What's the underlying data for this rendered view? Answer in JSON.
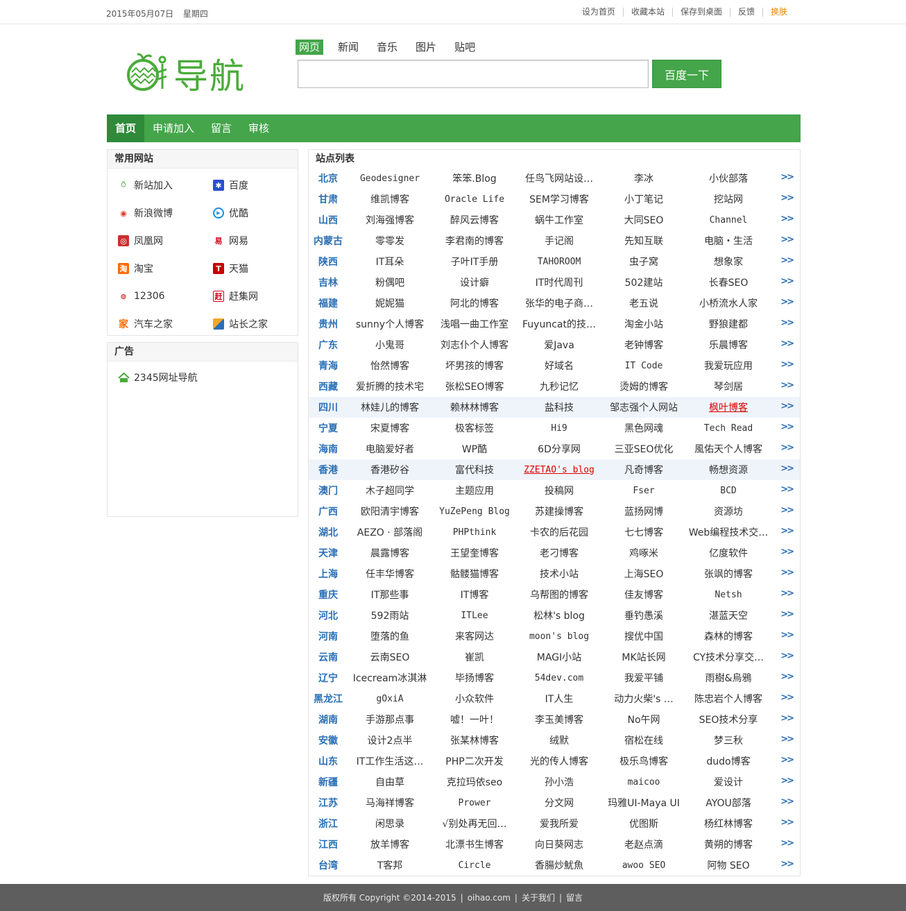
{
  "topbar": {
    "date": "2015年05月07日",
    "weekday": "星期四",
    "links": [
      "设为首页",
      "收藏本站",
      "保存到桌面",
      "反馈",
      "换肤"
    ]
  },
  "logo": {
    "text": "导航"
  },
  "search": {
    "tabs": [
      "网页",
      "新闻",
      "音乐",
      "图片",
      "贴吧"
    ],
    "active_tab": "网页",
    "button": "百度一下",
    "value": ""
  },
  "nav": {
    "items": [
      "首页",
      "申请加入",
      "留言",
      "审核"
    ]
  },
  "common_sites": {
    "title": "常用网站",
    "items": [
      {
        "label": "新站加入",
        "icon": "oihao-icon"
      },
      {
        "label": "百度",
        "icon": "baidu-paw-icon"
      },
      {
        "label": "新浪微博",
        "icon": "weibo-icon"
      },
      {
        "label": "优酷",
        "icon": "youku-icon"
      },
      {
        "label": "凤凰网",
        "icon": "ifeng-icon"
      },
      {
        "label": "网易",
        "icon": "netease-icon"
      },
      {
        "label": "淘宝",
        "icon": "taobao-icon"
      },
      {
        "label": "天猫",
        "icon": "tmall-icon"
      },
      {
        "label": "12306",
        "icon": "railway-icon"
      },
      {
        "label": "赶集网",
        "icon": "ganji-icon"
      },
      {
        "label": "汽车之家",
        "icon": "autohome-icon"
      },
      {
        "label": "站长之家",
        "icon": "chinaz-icon"
      }
    ]
  },
  "ads": {
    "title": "广告",
    "items": [
      {
        "label": "2345网址导航",
        "icon": "2345-icon"
      }
    ]
  },
  "site_list": {
    "title": "站点列表",
    "more": ">>",
    "rows": [
      {
        "prov": "北京",
        "sites": [
          "Geodesigner",
          "笨笨.Blog",
          "任鸟飞网站设…",
          "李冰",
          "小伙部落"
        ]
      },
      {
        "prov": "甘肃",
        "sites": [
          "维凯博客",
          "Oracle Life",
          "SEM学习博客",
          "小丁笔记",
          "挖站网"
        ]
      },
      {
        "prov": "山西",
        "sites": [
          "刘海强博客",
          "醉风云博客",
          "蜗牛工作室",
          "大同SEO",
          "Channel"
        ]
      },
      {
        "prov": "内蒙古",
        "sites": [
          "零零发",
          "李君南的博客",
          "手记阁",
          "先知互联",
          "电脑・生活"
        ]
      },
      {
        "prov": "陕西",
        "sites": [
          "IT耳朵",
          "子叶IT手册",
          "TAHOROOM",
          "虫子窝",
          "想象家"
        ]
      },
      {
        "prov": "吉林",
        "sites": [
          "粉偶吧",
          "设计癖",
          "IT时代周刊",
          "502建站",
          "长春SEO"
        ]
      },
      {
        "prov": "福建",
        "sites": [
          "妮妮猫",
          "阿北的博客",
          "张华的电子商…",
          "老五说",
          "小桥流水人家"
        ]
      },
      {
        "prov": "贵州",
        "sites": [
          "sunny个人博客",
          "浅唱一曲工作室",
          "Fuyuncat的技…",
          "淘金小站",
          "野狼建都"
        ]
      },
      {
        "prov": "广东",
        "sites": [
          "小鬼哥",
          "刘志仆个人博客",
          "爱Java",
          "老钟博客",
          "乐晨博客"
        ]
      },
      {
        "prov": "青海",
        "sites": [
          "怡然博客",
          "坏男孩的博客",
          "好域名",
          "IT Code",
          "我爱玩应用"
        ]
      },
      {
        "prov": "西藏",
        "sites": [
          "爱折腾的技术宅",
          "张松SEO博客",
          "九秒记忆",
          "烫姆的博客",
          "琴剑居"
        ]
      },
      {
        "prov": "四川",
        "sites": [
          "林娃儿的博客",
          "赖林林博客",
          "盐科技",
          "邹志强个人网站",
          "枫叶博客"
        ]
      },
      {
        "prov": "宁夏",
        "sites": [
          "宋夏博客",
          "极客标签",
          "Hi9",
          "黑色网魂",
          "Tech Read"
        ]
      },
      {
        "prov": "海南",
        "sites": [
          "电脑爱好者",
          "WP酷",
          "6D分享网",
          "三亚SEO优化",
          "風佑天个人博客"
        ]
      },
      {
        "prov": "香港",
        "sites": [
          "香港矽谷",
          "富代科技",
          "ZZETAO's blog",
          "凡奇博客",
          "畅想资源"
        ]
      },
      {
        "prov": "澳门",
        "sites": [
          "木子超同学",
          "主题应用",
          "投稿网",
          "Fser",
          "BCD"
        ]
      },
      {
        "prov": "广西",
        "sites": [
          "欧阳清宇博客",
          "YuZePeng Blog",
          "苏建操博客",
          "蓝扬网博",
          "资源坊"
        ]
      },
      {
        "prov": "湖北",
        "sites": [
          "AEZO · 部落阁",
          "PHPthink",
          "卡农的后花园",
          "七七博客",
          "Web编程技术交…"
        ]
      },
      {
        "prov": "天津",
        "sites": [
          "晨露博客",
          "王望奎博客",
          "老刁博客",
          "鸡啄米",
          "亿度软件"
        ]
      },
      {
        "prov": "上海",
        "sites": [
          "任丰华博客",
          "骷髅猫博客",
          "技术小站",
          "上海SEO",
          "张飒的博客"
        ]
      },
      {
        "prov": "重庆",
        "sites": [
          "IT那些事",
          "IT博客",
          "乌帮图的博客",
          "佳友博客",
          "Netsh"
        ]
      },
      {
        "prov": "河北",
        "sites": [
          "592雨站",
          "ITLee",
          "松林's blog",
          "垂钓愚溪",
          "湛蓝天空"
        ]
      },
      {
        "prov": "河南",
        "sites": [
          "堕落的鱼",
          "来客网达",
          "moon's blog",
          "搜优中国",
          "森林的博客"
        ]
      },
      {
        "prov": "云南",
        "sites": [
          "云南SEO",
          "崔凯",
          "MAGI小站",
          "MK站长网",
          "CY技术分享交…"
        ]
      },
      {
        "prov": "辽宁",
        "sites": [
          "Icecream冰淇淋",
          "毕扬博客",
          "54dev.com",
          "我爱平铺",
          "雨樹&烏鴉"
        ]
      },
      {
        "prov": "黑龙江",
        "sites": [
          "gOxiA",
          "小众软件",
          "IT人生",
          "动力火柴's …",
          "陈忠岩个人博客"
        ]
      },
      {
        "prov": "湖南",
        "sites": [
          "手游那点事",
          "嘘！一叶！",
          "李玉美博客",
          "No午网",
          "SEO技术分享"
        ]
      },
      {
        "prov": "安徽",
        "sites": [
          "设计2点半",
          "张某林博客",
          "绒默",
          "宿松在线",
          "梦三秋"
        ]
      },
      {
        "prov": "山东",
        "sites": [
          "IT工作生活这…",
          "PHP二次开发",
          "光的传人博客",
          "极乐鸟博客",
          "dudo博客"
        ]
      },
      {
        "prov": "新疆",
        "sites": [
          "自由草",
          "克拉玛依seo",
          "孙小浩",
          "maicoo",
          "爱设计"
        ]
      },
      {
        "prov": "江苏",
        "sites": [
          "马海祥博客",
          "Prower",
          "分文网",
          "玛雅UI-Maya UI",
          "AYOU部落"
        ]
      },
      {
        "prov": "浙江",
        "sites": [
          "闲思录",
          "√别处再无回…",
          "爱我所爱",
          "优图斯",
          "杨红林博客"
        ]
      },
      {
        "prov": "江西",
        "sites": [
          "放羊博客",
          "北漂书生博客",
          "向日葵网志",
          "老赵点滴",
          "黄朔的博客"
        ]
      },
      {
        "prov": "台湾",
        "sites": [
          "T客邦",
          "Circle",
          "香腸炒魷魚",
          "awoo SEO",
          "阿物 SEO"
        ]
      }
    ]
  },
  "footer": {
    "copyright": "版权所有 Copyright ©2014-2015",
    "domain": "oihao.com",
    "about": "关于我们",
    "message": "留言"
  },
  "colors": {
    "accent": "#44a54a",
    "province": "#2b70b5",
    "highlight_link": "#dd0000",
    "footer_bg": "#5e5e5e"
  }
}
